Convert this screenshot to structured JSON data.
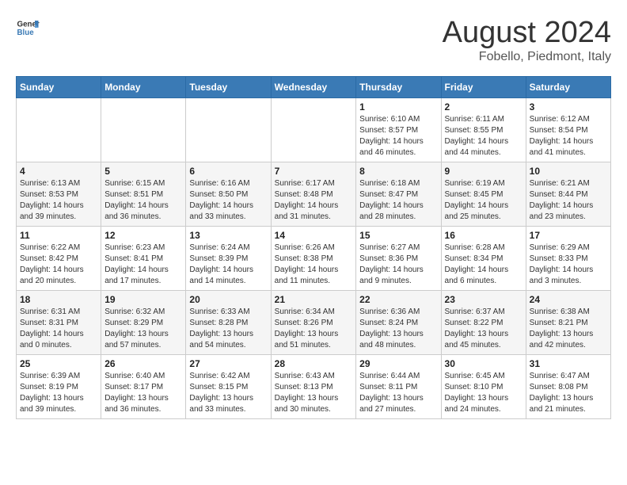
{
  "logo": {
    "line1": "General",
    "line2": "Blue"
  },
  "title": "August 2024",
  "location": "Fobello, Piedmont, Italy",
  "days_of_week": [
    "Sunday",
    "Monday",
    "Tuesday",
    "Wednesday",
    "Thursday",
    "Friday",
    "Saturday"
  ],
  "weeks": [
    [
      {
        "day": "",
        "info": ""
      },
      {
        "day": "",
        "info": ""
      },
      {
        "day": "",
        "info": ""
      },
      {
        "day": "",
        "info": ""
      },
      {
        "day": "1",
        "info": "Sunrise: 6:10 AM\nSunset: 8:57 PM\nDaylight: 14 hours\nand 46 minutes."
      },
      {
        "day": "2",
        "info": "Sunrise: 6:11 AM\nSunset: 8:55 PM\nDaylight: 14 hours\nand 44 minutes."
      },
      {
        "day": "3",
        "info": "Sunrise: 6:12 AM\nSunset: 8:54 PM\nDaylight: 14 hours\nand 41 minutes."
      }
    ],
    [
      {
        "day": "4",
        "info": "Sunrise: 6:13 AM\nSunset: 8:53 PM\nDaylight: 14 hours\nand 39 minutes."
      },
      {
        "day": "5",
        "info": "Sunrise: 6:15 AM\nSunset: 8:51 PM\nDaylight: 14 hours\nand 36 minutes."
      },
      {
        "day": "6",
        "info": "Sunrise: 6:16 AM\nSunset: 8:50 PM\nDaylight: 14 hours\nand 33 minutes."
      },
      {
        "day": "7",
        "info": "Sunrise: 6:17 AM\nSunset: 8:48 PM\nDaylight: 14 hours\nand 31 minutes."
      },
      {
        "day": "8",
        "info": "Sunrise: 6:18 AM\nSunset: 8:47 PM\nDaylight: 14 hours\nand 28 minutes."
      },
      {
        "day": "9",
        "info": "Sunrise: 6:19 AM\nSunset: 8:45 PM\nDaylight: 14 hours\nand 25 minutes."
      },
      {
        "day": "10",
        "info": "Sunrise: 6:21 AM\nSunset: 8:44 PM\nDaylight: 14 hours\nand 23 minutes."
      }
    ],
    [
      {
        "day": "11",
        "info": "Sunrise: 6:22 AM\nSunset: 8:42 PM\nDaylight: 14 hours\nand 20 minutes."
      },
      {
        "day": "12",
        "info": "Sunrise: 6:23 AM\nSunset: 8:41 PM\nDaylight: 14 hours\nand 17 minutes."
      },
      {
        "day": "13",
        "info": "Sunrise: 6:24 AM\nSunset: 8:39 PM\nDaylight: 14 hours\nand 14 minutes."
      },
      {
        "day": "14",
        "info": "Sunrise: 6:26 AM\nSunset: 8:38 PM\nDaylight: 14 hours\nand 11 minutes."
      },
      {
        "day": "15",
        "info": "Sunrise: 6:27 AM\nSunset: 8:36 PM\nDaylight: 14 hours\nand 9 minutes."
      },
      {
        "day": "16",
        "info": "Sunrise: 6:28 AM\nSunset: 8:34 PM\nDaylight: 14 hours\nand 6 minutes."
      },
      {
        "day": "17",
        "info": "Sunrise: 6:29 AM\nSunset: 8:33 PM\nDaylight: 14 hours\nand 3 minutes."
      }
    ],
    [
      {
        "day": "18",
        "info": "Sunrise: 6:31 AM\nSunset: 8:31 PM\nDaylight: 14 hours\nand 0 minutes."
      },
      {
        "day": "19",
        "info": "Sunrise: 6:32 AM\nSunset: 8:29 PM\nDaylight: 13 hours\nand 57 minutes."
      },
      {
        "day": "20",
        "info": "Sunrise: 6:33 AM\nSunset: 8:28 PM\nDaylight: 13 hours\nand 54 minutes."
      },
      {
        "day": "21",
        "info": "Sunrise: 6:34 AM\nSunset: 8:26 PM\nDaylight: 13 hours\nand 51 minutes."
      },
      {
        "day": "22",
        "info": "Sunrise: 6:36 AM\nSunset: 8:24 PM\nDaylight: 13 hours\nand 48 minutes."
      },
      {
        "day": "23",
        "info": "Sunrise: 6:37 AM\nSunset: 8:22 PM\nDaylight: 13 hours\nand 45 minutes."
      },
      {
        "day": "24",
        "info": "Sunrise: 6:38 AM\nSunset: 8:21 PM\nDaylight: 13 hours\nand 42 minutes."
      }
    ],
    [
      {
        "day": "25",
        "info": "Sunrise: 6:39 AM\nSunset: 8:19 PM\nDaylight: 13 hours\nand 39 minutes."
      },
      {
        "day": "26",
        "info": "Sunrise: 6:40 AM\nSunset: 8:17 PM\nDaylight: 13 hours\nand 36 minutes."
      },
      {
        "day": "27",
        "info": "Sunrise: 6:42 AM\nSunset: 8:15 PM\nDaylight: 13 hours\nand 33 minutes."
      },
      {
        "day": "28",
        "info": "Sunrise: 6:43 AM\nSunset: 8:13 PM\nDaylight: 13 hours\nand 30 minutes."
      },
      {
        "day": "29",
        "info": "Sunrise: 6:44 AM\nSunset: 8:11 PM\nDaylight: 13 hours\nand 27 minutes."
      },
      {
        "day": "30",
        "info": "Sunrise: 6:45 AM\nSunset: 8:10 PM\nDaylight: 13 hours\nand 24 minutes."
      },
      {
        "day": "31",
        "info": "Sunrise: 6:47 AM\nSunset: 8:08 PM\nDaylight: 13 hours\nand 21 minutes."
      }
    ]
  ]
}
